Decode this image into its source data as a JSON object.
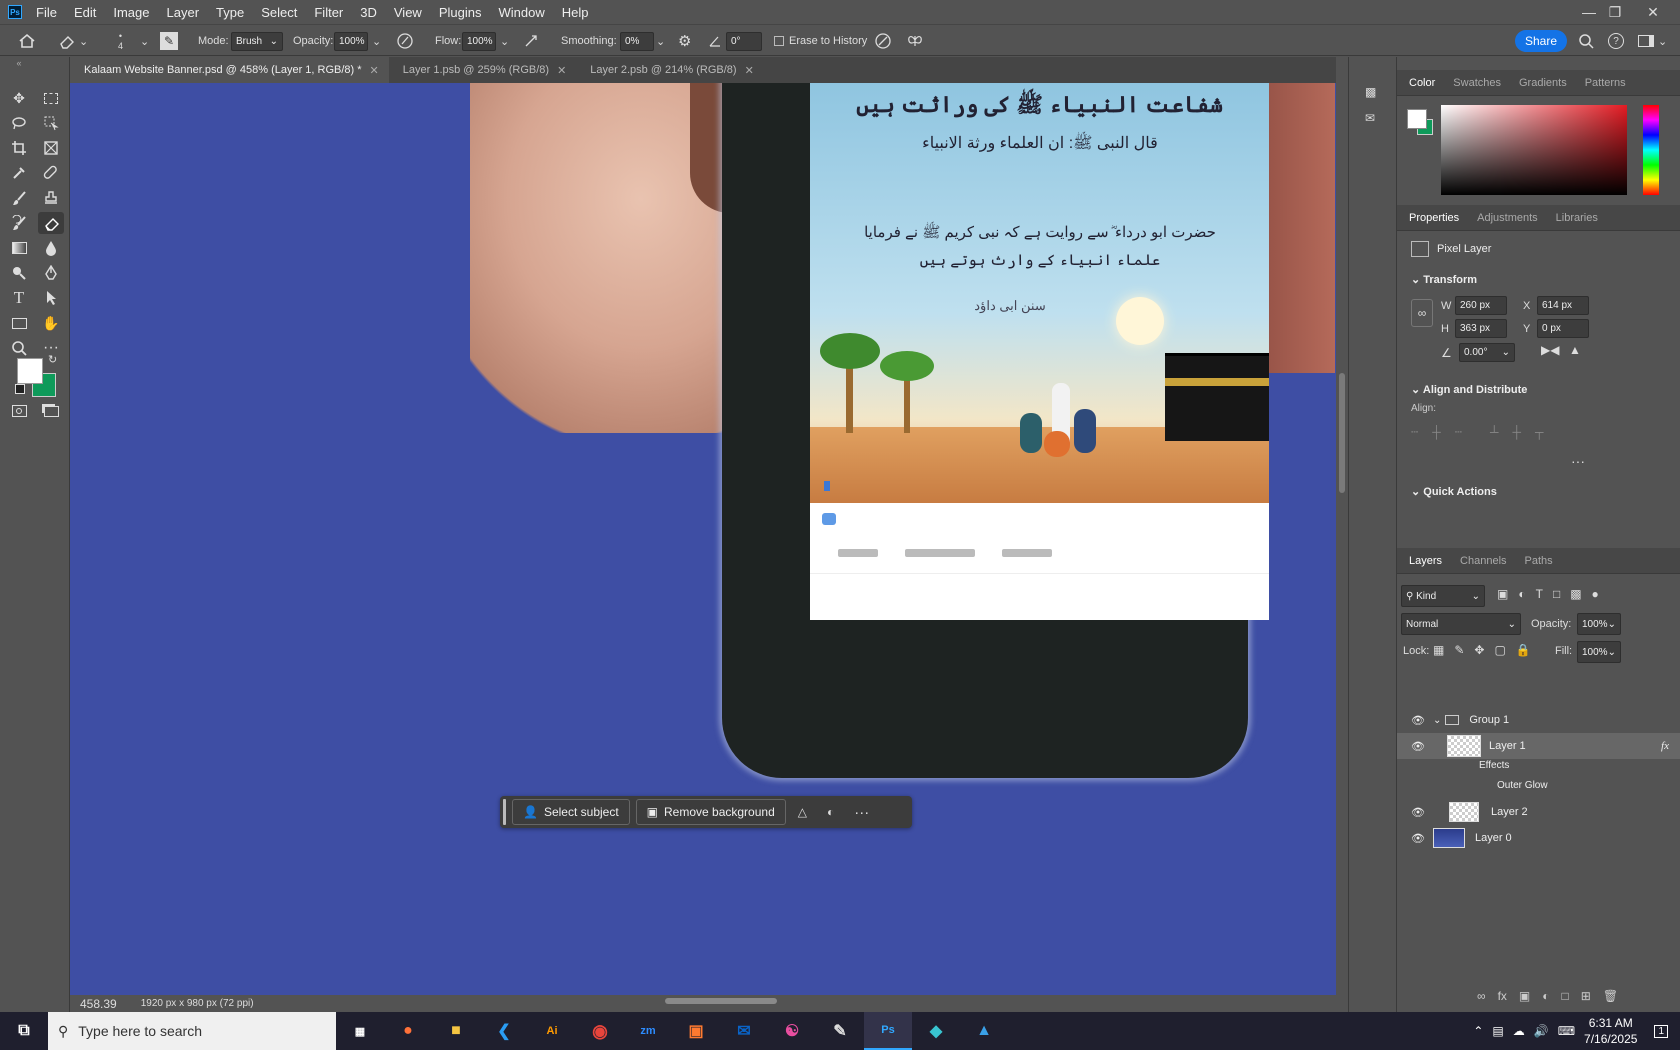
{
  "app": {
    "logo": "Ps"
  },
  "menu": [
    "File",
    "Edit",
    "Image",
    "Layer",
    "Type",
    "Select",
    "Filter",
    "3D",
    "View",
    "Plugins",
    "Window",
    "Help"
  ],
  "options": {
    "brush_size": "4",
    "mode_label": "Mode:",
    "mode_value": "Brush",
    "opacity_label": "Opacity:",
    "opacity_value": "100%",
    "flow_label": "Flow:",
    "flow_value": "100%",
    "smoothing_label": "Smoothing:",
    "smoothing_value": "0%",
    "angle_value": "0°",
    "erase_history": "Erase to History",
    "share": "Share"
  },
  "tabs": [
    {
      "label": "Kalaam Website Banner.psd @ 458% (Layer 1, RGB/8) *",
      "active": true
    },
    {
      "label": "Layer 1.psb @ 259% (RGB/8)",
      "active": false
    },
    {
      "label": "Layer 2.psb @ 214% (RGB/8)",
      "active": false
    }
  ],
  "status": {
    "zoom": "458.39",
    "doc": "1920 px x 980 px (72 ppi)"
  },
  "context_bar": {
    "select_subject": "Select subject",
    "remove_background": "Remove background"
  },
  "color_panel": {
    "tabs": [
      "Color",
      "Swatches",
      "Gradients",
      "Patterns"
    ],
    "fg": "#ffffff",
    "bg": "#0e9a5a"
  },
  "properties": {
    "tabs": [
      "Properties",
      "Adjustments",
      "Libraries"
    ],
    "layer_type": "Pixel Layer",
    "transform_title": "Transform",
    "w_label": "W",
    "w": "260 px",
    "h_label": "H",
    "h": "363 px",
    "x_label": "X",
    "x": "614 px",
    "y_label": "Y",
    "y": "0 px",
    "angle": "0.00°",
    "align_title": "Align and Distribute",
    "align_label": "Align:",
    "quick_actions": "Quick Actions"
  },
  "layers_panel": {
    "tabs": [
      "Layers",
      "Channels",
      "Paths"
    ],
    "kind": "Kind",
    "blend": "Normal",
    "opacity_label": "Opacity:",
    "opacity": "100%",
    "lock_label": "Lock:",
    "fill_label": "Fill:",
    "fill": "100%",
    "group": "Group 1",
    "layer1": "Layer 1",
    "effects": "Effects",
    "outer_glow": "Outer Glow",
    "layer2": "Layer 2",
    "layer0": "Layer 0"
  },
  "taskbar": {
    "search": "Type here to search",
    "time": "6:31 AM",
    "date": "7/16/2025",
    "notif": "1"
  },
  "banner": {
    "urdu_title": "شفاعت النبیاء ﷺ کی وراثت ہیں",
    "urdu_1": "قال النبی ﷺ: ان العلماء ورثة الانبیاء",
    "urdu_2": "حضرت ابو درداء ؓ سے روایت ہے کہ نبی کریم ﷺ نے فرمایا",
    "urdu_3": "علماء انبیاء کے وارث ہوتے ہیں",
    "caption": "سنن ابی داؤد"
  }
}
